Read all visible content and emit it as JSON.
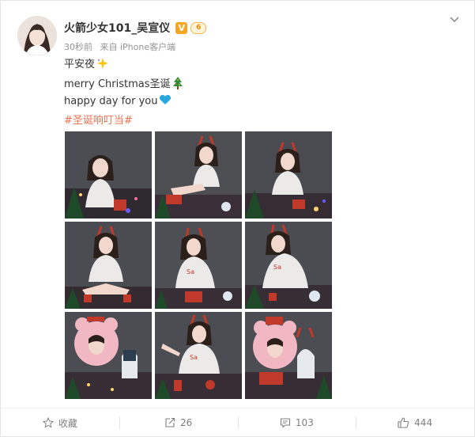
{
  "post": {
    "username": "火箭少女101_吴宣仪",
    "verified_badge": "V",
    "level_badge": "6",
    "time": "30秒前",
    "source": "来自 iPhone客户端",
    "lines": [
      "平安夜",
      "merry Christmas圣诞",
      "happy day for you"
    ],
    "hashtag": "#圣诞响叮当#",
    "emoji": [
      "sparkle-icon",
      "christmas-tree-icon",
      "blue-heart-icon"
    ]
  },
  "photos": [
    {
      "label": "photo-1"
    },
    {
      "label": "photo-2"
    },
    {
      "label": "photo-3"
    },
    {
      "label": "photo-4"
    },
    {
      "label": "photo-5"
    },
    {
      "label": "photo-6"
    },
    {
      "label": "photo-7"
    },
    {
      "label": "photo-8"
    },
    {
      "label": "photo-9"
    }
  ],
  "footer": {
    "favorite_label": "收藏",
    "repost_count": "26",
    "comment_count": "103",
    "like_count": "444"
  },
  "colors": {
    "hashtag": "#eb7350",
    "badge": "#f5a623",
    "meta": "#939393",
    "heart": "#29a8e0"
  }
}
